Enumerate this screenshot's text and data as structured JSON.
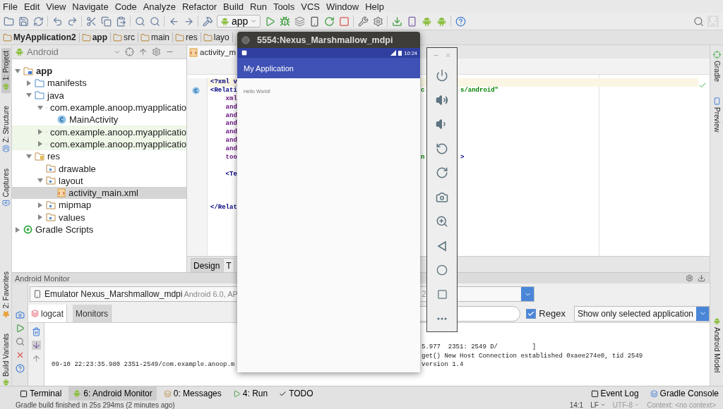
{
  "menu": [
    "File",
    "Edit",
    "View",
    "Navigate",
    "Code",
    "Analyze",
    "Refactor",
    "Build",
    "Run",
    "Tools",
    "VCS",
    "Window",
    "Help"
  ],
  "toolbar": {
    "run_config": "app"
  },
  "breadcrumbs": [
    "MyApplication2",
    "app",
    "src",
    "main",
    "res",
    "layo"
  ],
  "left_strip": [
    {
      "label": "1: Project",
      "selected": true
    },
    {
      "label": "Z: Structure",
      "selected": false
    },
    {
      "label": "Captures",
      "selected": false
    },
    {
      "label": "2: Favorites",
      "selected": false
    },
    {
      "label": "Build Variants",
      "selected": false
    }
  ],
  "right_strip": [
    "Gradle",
    "Preview",
    "Android Model"
  ],
  "project": {
    "view": "Android",
    "tree": [
      {
        "label": "app",
        "kind": "module",
        "expanded": true,
        "selected": false,
        "test": false,
        "children": [
          {
            "label": "manifests",
            "kind": "folder",
            "expanded": false,
            "selected": false,
            "test": false
          },
          {
            "label": "java",
            "kind": "folder",
            "expanded": true,
            "selected": false,
            "test": false,
            "children": [
              {
                "label": "com.example.anoop.myapplicatio",
                "kind": "package",
                "expanded": true,
                "selected": false,
                "test": false,
                "children": [
                  {
                    "label": "MainActivity",
                    "kind": "class",
                    "selected": false,
                    "test": false
                  }
                ]
              },
              {
                "label": "com.example.anoop.myapplicatio",
                "kind": "package",
                "expanded": false,
                "selected": false,
                "test": true
              },
              {
                "label": "com.example.anoop.myapplicatio",
                "kind": "package",
                "expanded": false,
                "selected": false,
                "test": true
              }
            ]
          },
          {
            "label": "res",
            "kind": "resfolder",
            "expanded": true,
            "selected": false,
            "test": false,
            "children": [
              {
                "label": "drawable",
                "kind": "package",
                "selected": false,
                "test": false
              },
              {
                "label": "layout",
                "kind": "package",
                "expanded": true,
                "selected": false,
                "test": false,
                "children": [
                  {
                    "label": "activity_main.xml",
                    "kind": "file",
                    "selected": true,
                    "test": false
                  }
                ]
              },
              {
                "label": "mipmap",
                "kind": "package",
                "expanded": false,
                "selected": false,
                "test": false
              },
              {
                "label": "values",
                "kind": "package",
                "expanded": false,
                "selected": false,
                "test": false
              }
            ]
          }
        ]
      },
      {
        "label": "Gradle Scripts",
        "kind": "gradle",
        "expanded": false,
        "selected": false,
        "test": false
      }
    ]
  },
  "editor": {
    "tab": "activity_m",
    "lines": [
      {
        "kind": "tag",
        "text": "<?xml v",
        "current": true
      },
      {
        "kind": "tag",
        "text": "<Relati",
        "mid": "c",
        "right": "s/android\"",
        "current": false
      },
      {
        "kind": "attr",
        "text": "    xml",
        "current": false
      },
      {
        "kind": "attr",
        "text": "    and",
        "current": false
      },
      {
        "kind": "attr",
        "text": "    and",
        "current": false
      },
      {
        "kind": "attr",
        "text": "    and",
        "current": false
      },
      {
        "kind": "attr",
        "text": "    and",
        "current": false
      },
      {
        "kind": "attr",
        "text": "    and",
        "current": false
      },
      {
        "kind": "attr",
        "text": "    and",
        "current": false
      },
      {
        "kind": "attr",
        "text": "    too",
        "mid": "n",
        "right": ">",
        "current": false
      },
      {
        "kind": "blank",
        "current": false
      },
      {
        "kind": "tag",
        "text": "    <Te",
        "current": false
      },
      {
        "kind": "blank",
        "current": false
      },
      {
        "kind": "blank",
        "current": false
      },
      {
        "kind": "blank",
        "current": false
      },
      {
        "kind": "tag",
        "text": "</Relat",
        "current": false
      }
    ],
    "bottom_tabs": [
      {
        "label": "Design",
        "selected": true
      },
      {
        "label": "T",
        "selected": false
      }
    ]
  },
  "monitor": {
    "title": "Android Monitor",
    "device": {
      "name": "Emulator Nexus_Marshmallow_mdpi",
      "detail": "Android 6.0, AP"
    },
    "process": "2",
    "tabs": [
      {
        "label": "logcat",
        "selected": true
      },
      {
        "label": "Monitors",
        "selected": false
      }
    ],
    "regex": {
      "label": "Regex",
      "checked": true
    },
    "filter": "Show only selected application",
    "log": [
      {
        "right": "5.977  2351: 2549 D/         ]"
      },
      {
        "right": "get() New Host Connection established 0xaee274e0, tid 2549"
      },
      {
        "left": "09-10 22:23:35.980 2351-2549/com.example.anoop.m",
        "right": "version 1.4"
      }
    ]
  },
  "tool_windows": [
    {
      "label": "Terminal",
      "selected": false
    },
    {
      "label": "6: Android Monitor",
      "selected": true
    },
    {
      "label": "0: Messages",
      "selected": false
    },
    {
      "label": "4: Run",
      "selected": false
    },
    {
      "label": "TODO",
      "selected": false
    }
  ],
  "right_tools": [
    "Event Log",
    "Gradle Console"
  ],
  "status": {
    "message": "Gradle build finished in 25s 294ms (2 minutes ago)",
    "position": "14:1",
    "line_sep": "LF",
    "encoding": "UTF-8",
    "context": "Context: <no context>"
  },
  "emulator": {
    "title": "5554:Nexus_Marshmallow_mdpi",
    "time": "10:24",
    "app_title": "My Application",
    "content": "Hello World!"
  }
}
